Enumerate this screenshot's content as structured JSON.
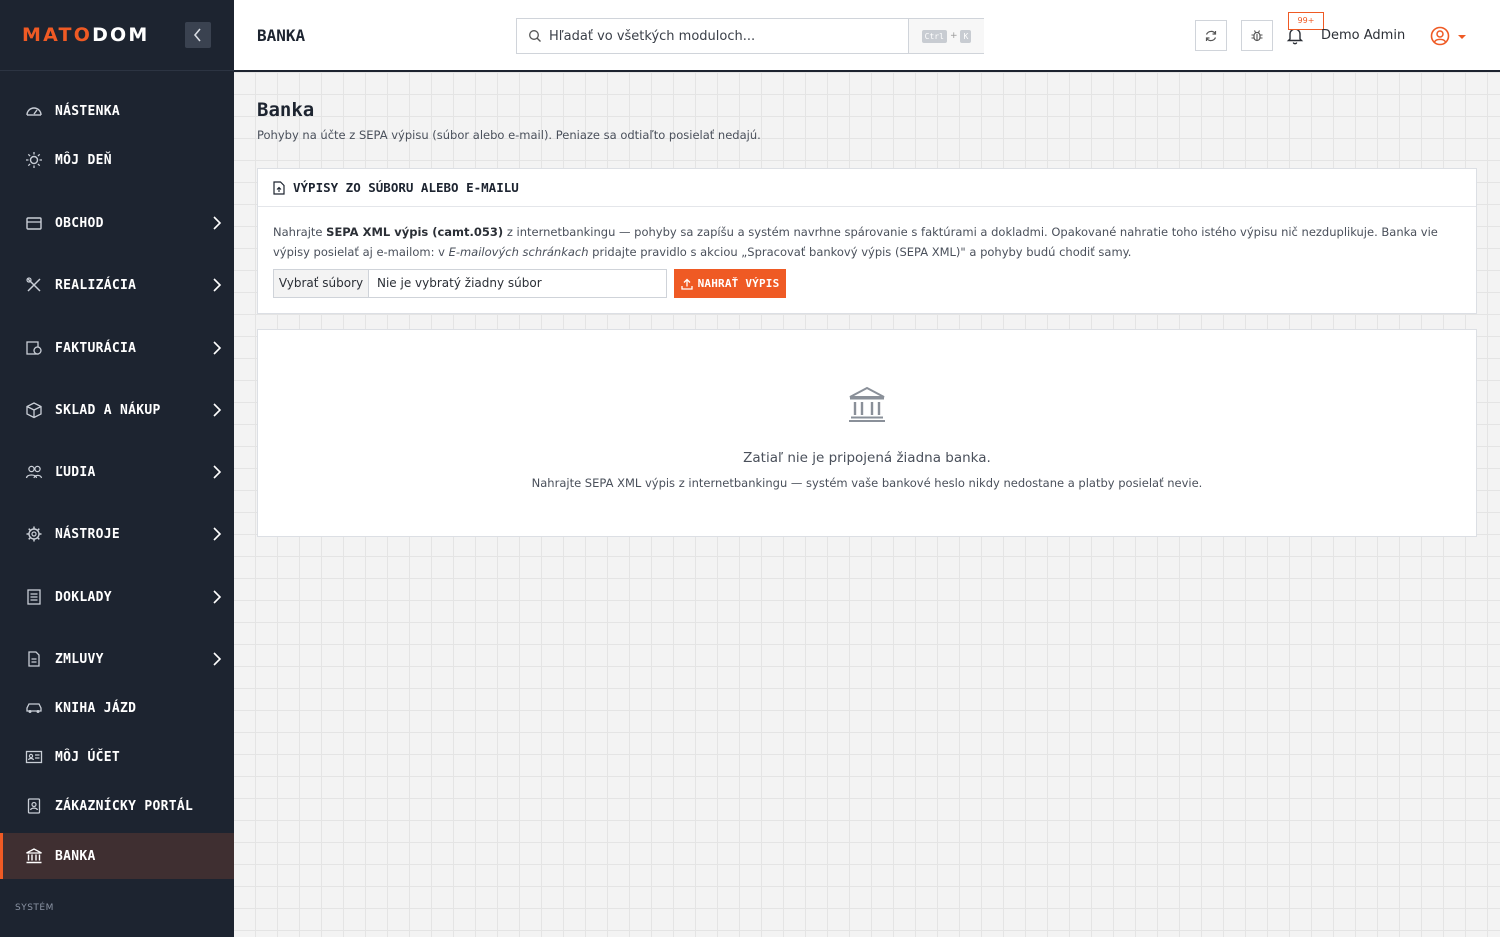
{
  "app": {
    "logo_part1": "MATO",
    "logo_part2": "DOM"
  },
  "sidebar": {
    "items": [
      {
        "label": "NÁSTENKA",
        "icon": "dashboard-gauge-icon"
      },
      {
        "label": "MÔJ DEŇ",
        "icon": "sun-icon"
      },
      {
        "label": "OBCHOD",
        "icon": "inbox-icon"
      },
      {
        "label": "REALIZÁCIA",
        "icon": "tools-icon"
      },
      {
        "label": "FAKTURÁCIA",
        "icon": "invoice-icon"
      },
      {
        "label": "SKLAD A NÁKUP",
        "icon": "box-icon"
      },
      {
        "label": "ĽUDIA",
        "icon": "people-icon"
      },
      {
        "label": "NÁSTROJE",
        "icon": "gear-icon"
      },
      {
        "label": "DOKLADY",
        "icon": "document-list-icon"
      },
      {
        "label": "ZMLUVY",
        "icon": "contract-icon"
      },
      {
        "label": "KNIHA JÁZD",
        "icon": "car-icon"
      },
      {
        "label": "MÔJ ÚČET",
        "icon": "id-card-icon"
      },
      {
        "label": "ZÁKAZNÍCKY PORTÁL",
        "icon": "portal-icon"
      },
      {
        "label": "BANKA",
        "icon": "bank-icon"
      }
    ],
    "active": "BANKA",
    "section_label": "SYSTÉM"
  },
  "topbar": {
    "page_heading": "BANKA",
    "search_placeholder": "Hľadať vo všetkých moduloch...",
    "shortcut_key1": "Ctrl",
    "shortcut_plus": "+",
    "shortcut_key2": "K",
    "notification_badge": "99+",
    "user_name": "Demo Admin"
  },
  "main": {
    "title": "Banka",
    "subtitle": "Pohyby na účte z SEPA výpisu (súbor alebo e-mail). Peniaze sa odtiaľto posielať nedajú.",
    "upload_card": {
      "title": "VÝPISY ZO SÚBORU ALEBO E-MAILU",
      "text_1": "Nahrajte ",
      "text_bold": "SEPA XML výpis (camt.053)",
      "text_2": " z internetbankingu — pohyby sa zapíšu a systém navrhne spárovanie s faktúrami a dokladmi. Opakované nahratie toho istého výpisu nič nezduplikuje. Banka vie výpisy posielať aj e-mailom: v ",
      "text_italic": "E-mailových schránkach",
      "text_3": " pridajte pravidlo s akciou „Spracovať bankový výpis (SEPA XML)\" a pohyby budú chodiť samy.",
      "file_button": "Vybrať súbory",
      "file_status": "Nie je vybratý žiadny súbor",
      "upload_button": "NAHRAŤ VÝPIS"
    },
    "empty_state": {
      "title": "Zatiaľ nie je pripojená žiadna banka.",
      "text": "Nahrajte SEPA XML výpis z internetbankingu — systém vaše bankové heslo nikdy nedostane a platby posielať nevie."
    }
  },
  "colors": {
    "accent": "#ef5a24",
    "sidebar_bg": "#1d2430",
    "active_item_bg": "#3f2f31"
  }
}
